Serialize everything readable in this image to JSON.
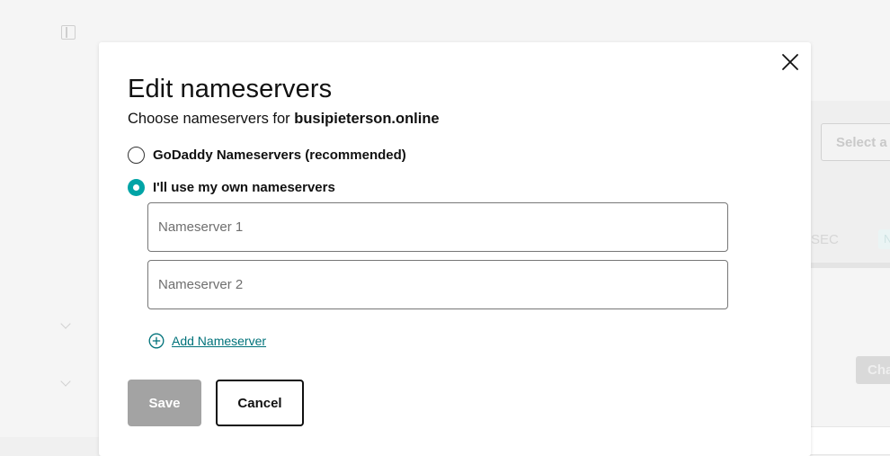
{
  "background": {
    "select_placeholder": "Select a",
    "dnssec_label": "SEC",
    "badge_text": "N",
    "change_button": "Cha"
  },
  "modal": {
    "title": "Edit nameservers",
    "subtitle_prefix": "Choose nameservers for ",
    "domain": "busipieterson.online",
    "options": [
      {
        "label": "GoDaddy Nameservers (recommended)",
        "selected": false
      },
      {
        "label": "I'll use my own nameservers",
        "selected": true
      }
    ],
    "nameserver_1": {
      "placeholder": "Nameserver 1",
      "value": ""
    },
    "nameserver_2": {
      "placeholder": "Nameserver 2",
      "value": ""
    },
    "add_nameserver_label": "Add Nameserver",
    "save_label": "Save",
    "cancel_label": "Cancel"
  },
  "colors": {
    "accent": "#00a4a6",
    "link": "#00727a",
    "save_disabled": "#a3a3a3"
  },
  "icons": [
    "close-icon",
    "plus-circle-icon",
    "sidebar-toggle-icon",
    "chevron-down-icon"
  ]
}
